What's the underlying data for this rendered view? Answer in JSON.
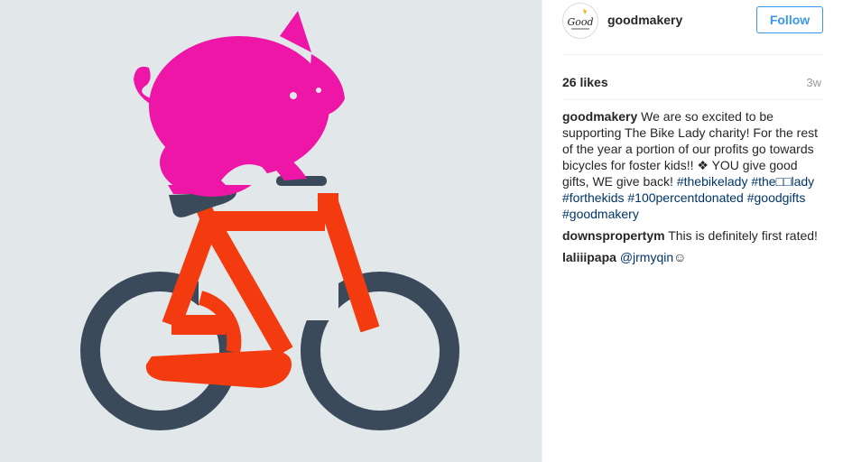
{
  "post": {
    "username": "goodmakery",
    "follow_label": "Follow",
    "avatar_text": "Good",
    "likes": "26 likes",
    "time": "3w"
  },
  "comments": [
    {
      "user": "goodmakery",
      "text": "We are so excited to be supporting The Bike Lady charity! For the rest of the year a portion of our profits go towards bicycles for foster kids!! ❖ YOU give good gifts, WE give back!",
      "tags": [
        "#thebikelady",
        "#the□□lady",
        "#forthekids",
        "#100percentdonated",
        "#goodgifts",
        "#goodmakery"
      ]
    },
    {
      "user": "downspropertym",
      "text": "This is definitely first rated!"
    },
    {
      "user": "laliiipapa",
      "mention": "@jrmyqin",
      "emoji": "☺"
    }
  ],
  "colors": {
    "photo_bg": "#e2e8ea",
    "pig": "#ee16a6",
    "bike_frame": "#f33b0f",
    "wheels": "#3a4a5a",
    "follow_blue": "#3897f0",
    "link": "#003569"
  }
}
